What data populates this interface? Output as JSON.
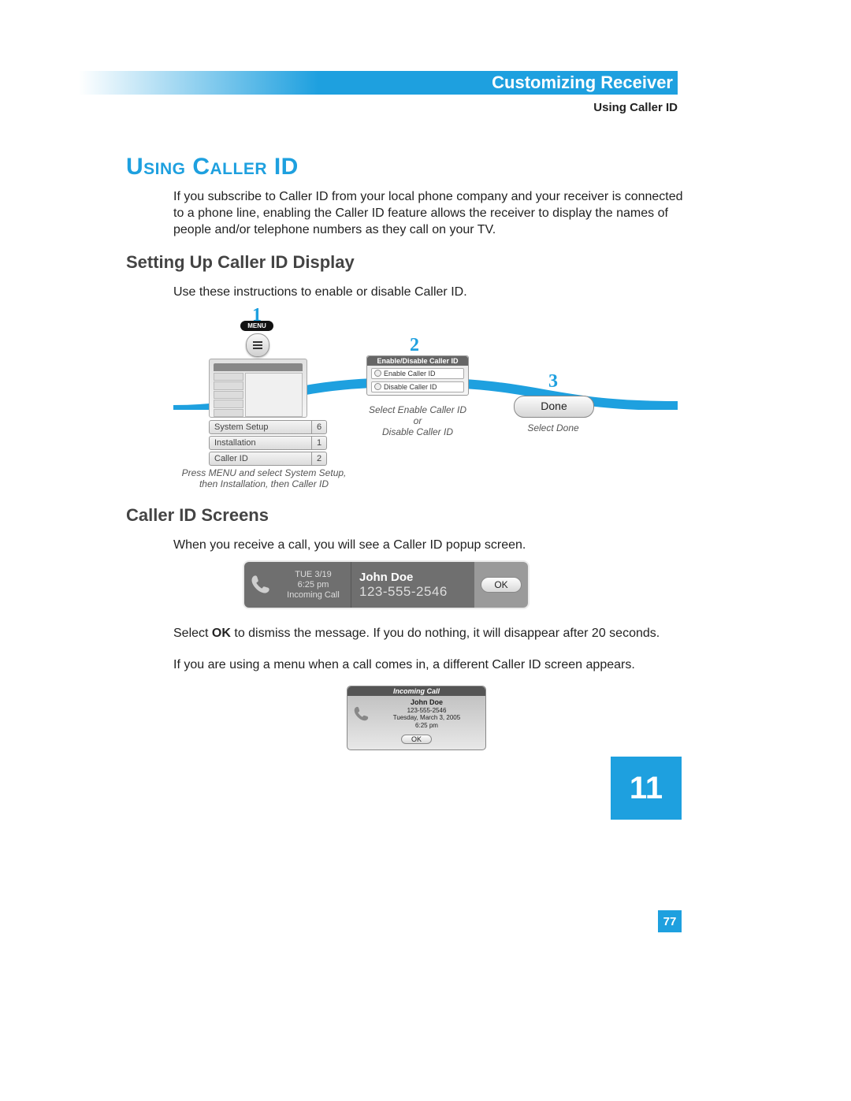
{
  "header": {
    "chapter_title": "Customizing Receiver",
    "section_label": "Using Caller ID"
  },
  "heading": "Using Caller ID",
  "intro_paragraph": "If you subscribe to Caller ID from your local phone company and your receiver is connected to a phone line, enabling the Caller ID feature allows the receiver to display the names of people and/or telephone numbers as they call on your TV.",
  "setup": {
    "heading": "Setting Up Caller ID Display",
    "paragraph": "Use these instructions to enable or disable Caller ID.",
    "step1": {
      "number": "1",
      "menu_chip": "MENU",
      "rows": [
        {
          "label": "System Setup",
          "num": "6"
        },
        {
          "label": "Installation",
          "num": "1"
        },
        {
          "label": "Caller ID",
          "num": "2"
        }
      ],
      "caption": "Press MENU and select System Setup, then Installation, then Caller ID"
    },
    "step2": {
      "number": "2",
      "dialog_title": "Enable/Disable Caller ID",
      "option_enable": "Enable Caller ID",
      "option_disable": "Disable Caller ID",
      "caption": "Select Enable Caller ID or Disable Caller ID"
    },
    "step3": {
      "number": "3",
      "button": "Done",
      "caption": "Select Done"
    }
  },
  "screens": {
    "heading": "Caller ID Screens",
    "para1": "When you receive a call, you will see a Caller ID popup screen.",
    "popup": {
      "date": "TUE 3/19",
      "time": "6:25 pm",
      "status": "Incoming Call",
      "name": "John Doe",
      "phone": "123-555-2546",
      "ok": "OK"
    },
    "para2_pre": "Select ",
    "para2_bold": "OK",
    "para2_post": " to dismiss the message. If you do nothing, it will disappear after 20 seconds.",
    "para3": "If you are using a menu when a call comes in, a different Caller ID screen appears.",
    "popup2": {
      "title": "Incoming Call",
      "name": "John Doe",
      "phone": "123-555-2546",
      "date_long": "Tuesday, March 3, 2005",
      "time": "6:25 pm",
      "ok": "OK"
    }
  },
  "chapter_number": "11",
  "page_number": "77"
}
